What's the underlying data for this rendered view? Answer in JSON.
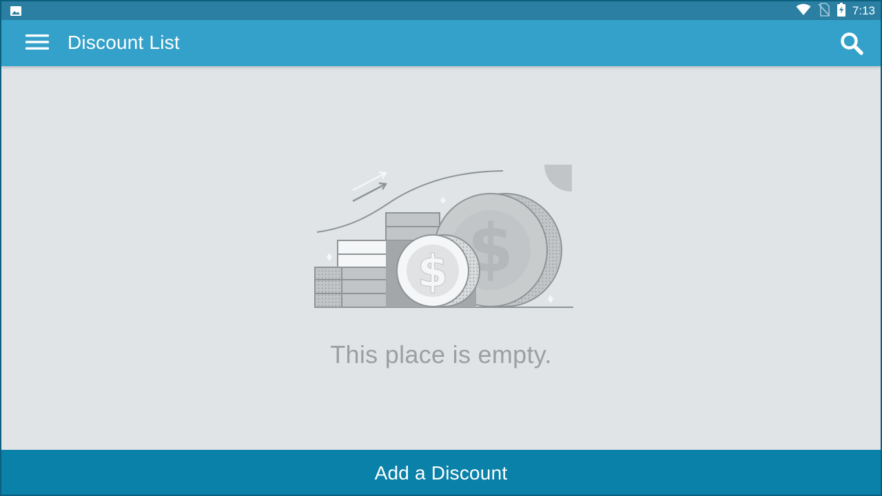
{
  "status_bar": {
    "time": "7:13",
    "icons": [
      "image-icon",
      "wifi-icon",
      "no-sim-icon",
      "battery-charging-icon"
    ]
  },
  "app_bar": {
    "title": "Discount List",
    "menu_icon": "hamburger-menu-icon",
    "search_icon": "search-icon"
  },
  "empty_state": {
    "illustration": "money-stack-coins-illustration",
    "message": "This place is empty."
  },
  "bottom_action": {
    "label": "Add a Discount"
  },
  "colors": {
    "status_bar": "#2a7fa2",
    "app_bar": "#33a1c9",
    "content_bg": "#e0e4e7",
    "bottom_button": "#0a81a8",
    "empty_text": "#9b9fa2"
  }
}
